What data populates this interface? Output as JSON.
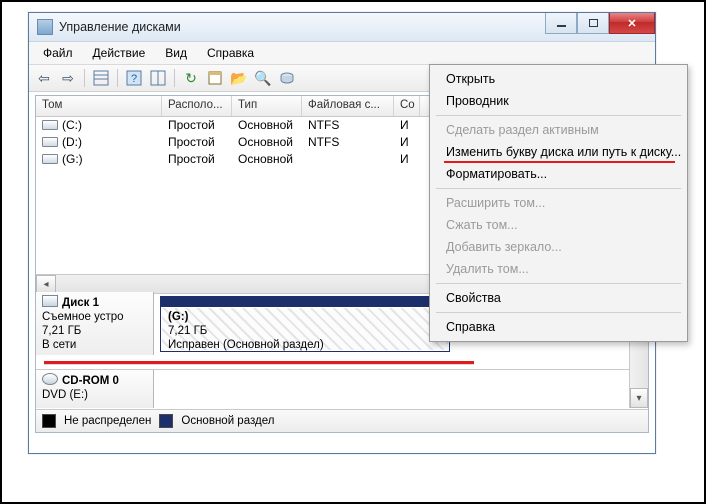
{
  "window": {
    "title": "Управление дисками"
  },
  "menu": {
    "file": "Файл",
    "action": "Действие",
    "view": "Вид",
    "help": "Справка"
  },
  "columns": {
    "volume": "Том",
    "layout": "Располо...",
    "type": "Тип",
    "fs": "Файловая с...",
    "status": "Со"
  },
  "volumes": [
    {
      "name": "(C:)",
      "layout": "Простой",
      "type": "Основной",
      "fs": "NTFS",
      "status": "И"
    },
    {
      "name": "(D:)",
      "layout": "Простой",
      "type": "Основной",
      "fs": "NTFS",
      "status": "И"
    },
    {
      "name": "(G:)",
      "layout": "Простой",
      "type": "Основной",
      "fs": "",
      "status": "И"
    }
  ],
  "disk1": {
    "title": "Диск 1",
    "kind": "Съемное устро",
    "size": "7,21 ГБ",
    "state": "В сети",
    "part": {
      "label": "(G:)",
      "size": "7,21 ГБ",
      "status": "Исправен (Основной раздел)"
    }
  },
  "cdrom": {
    "title": "CD-ROM 0",
    "line": "DVD (E:)"
  },
  "legend": {
    "unalloc": "Не распределен",
    "primary": "Основной раздел"
  },
  "ctx": {
    "open": "Открыть",
    "explorer": "Проводник",
    "active": "Сделать раздел активным",
    "change": "Изменить букву диска или путь к диску...",
    "format": "Форматировать...",
    "extend": "Расширить том...",
    "shrink": "Сжать том...",
    "mirror": "Добавить зеркало...",
    "delete": "Удалить том...",
    "props": "Свойства",
    "help": "Справка"
  }
}
